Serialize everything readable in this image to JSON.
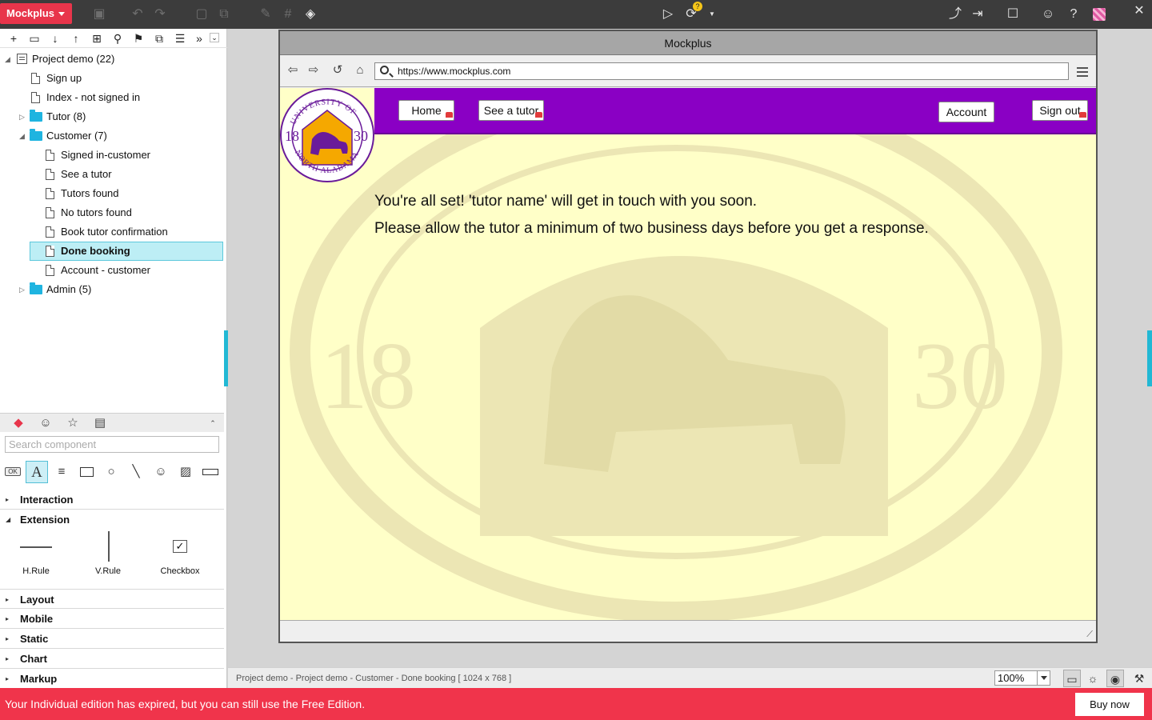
{
  "app": {
    "brand": "Mockplus",
    "window_title": "Mockplus"
  },
  "tree": {
    "project": "Project demo (22)",
    "items": [
      {
        "label": "Sign up",
        "kind": "page"
      },
      {
        "label": "Index - not signed in",
        "kind": "page"
      },
      {
        "label": "Tutor (8)",
        "kind": "folder",
        "expanded": false
      },
      {
        "label": "Customer (7)",
        "kind": "folder",
        "expanded": true
      },
      {
        "label": "Signed in-customer",
        "kind": "page"
      },
      {
        "label": "See a tutor",
        "kind": "page"
      },
      {
        "label": "Tutors found",
        "kind": "page"
      },
      {
        "label": "No tutors found",
        "kind": "page"
      },
      {
        "label": "Book tutor confirmation",
        "kind": "page"
      },
      {
        "label": "Done booking",
        "kind": "page",
        "selected": true
      },
      {
        "label": "Account - customer",
        "kind": "page"
      },
      {
        "label": "Admin (5)",
        "kind": "folder",
        "expanded": false
      }
    ]
  },
  "components": {
    "search_placeholder": "Search component",
    "sections": {
      "interaction": "Interaction",
      "extension": "Extension",
      "layout": "Layout",
      "mobile": "Mobile",
      "static": "Static",
      "chart": "Chart",
      "markup": "Markup"
    },
    "extension_items": {
      "hrule": "H.Rule",
      "vrule": "V.Rule",
      "checkbox": "Checkbox"
    },
    "basic_shapes": [
      "OK",
      "A"
    ]
  },
  "browser": {
    "url": "https://www.mockplus.com"
  },
  "site": {
    "nav": {
      "home": "Home",
      "see_tutor": "See a tutor",
      "account": "Account",
      "sign_out": "Sign out"
    },
    "logo": {
      "top": "UNIVERSITY OF",
      "bottom": "NORTH ALABAMA",
      "left_year": "18",
      "right_year": "30"
    },
    "message_1": "You're all set! 'tutor name' will get in touch with you soon.",
    "message_2": "Please allow the tutor a minimum of two business days before you get a response."
  },
  "status": {
    "path": "Project demo - Project demo - Customer - Done booking [ 1024 x 768 ]",
    "zoom": "100%"
  },
  "banner": {
    "text": "Your Individual edition has expired, but you can still use the Free Edition.",
    "buy": "Buy now"
  },
  "colors": {
    "brand": "#e8354b",
    "page_bg": "#ffffc8",
    "navbar": "#8a00c4",
    "selection": "#bdeef5",
    "banner": "#f0344b"
  }
}
